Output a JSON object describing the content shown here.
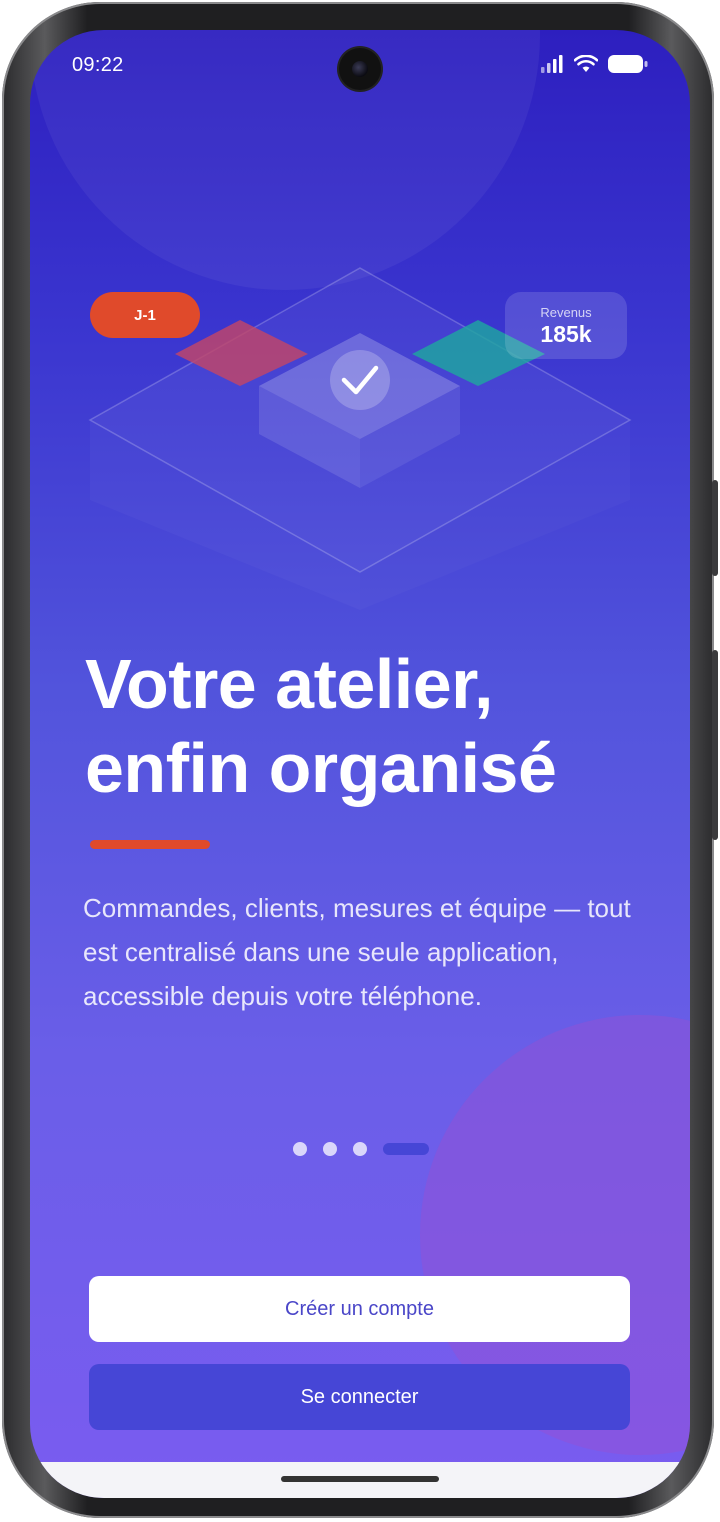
{
  "status_bar": {
    "time": "09:22",
    "icons": [
      "signal-icon",
      "wifi-icon",
      "battery-icon"
    ]
  },
  "illustration": {
    "badge": "J-1",
    "revenue_label": "Revenus",
    "revenue_value": "185k",
    "icons": [
      "check-icon"
    ]
  },
  "onboarding": {
    "headline_line1": "Votre atelier,",
    "headline_line2": "enfin organisé",
    "description": "Commandes, clients, mesures et équipe — tout est centralisé dans une seule application, accessible depuis votre téléphone.",
    "page_count": 4,
    "active_page": 4
  },
  "actions": {
    "create_account": "Créer un compte",
    "login": "Se connecter"
  },
  "colors": {
    "accent": "#e04a2b",
    "primary": "#4646d6",
    "background_top": "#2d1fbf",
    "background_bottom": "#7a5cf0"
  }
}
